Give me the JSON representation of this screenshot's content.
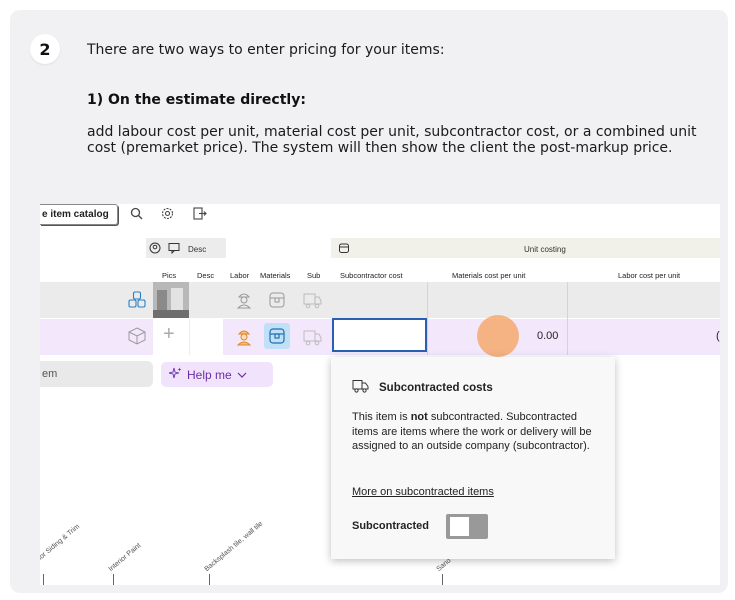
{
  "step": {
    "number": "2",
    "intro": "There are two ways to enter pricing for your items:",
    "method_heading": "1) On the estimate directly:",
    "paragraph": "add labour cost per unit, material cost per unit, subcontractor cost, or a combined unit cost (premarket price). The system will then show the client the post-markup price."
  },
  "app": {
    "toolbar": {
      "catalog_button": "e item catalog",
      "icons": [
        "search-icon",
        "settings-icon",
        "export-icon"
      ]
    },
    "group_headers": {
      "desc": "Desc",
      "unit_costing": "Unit costing"
    },
    "columns": [
      "Pics",
      "Desc",
      "Labor",
      "Materials",
      "Sub",
      "Subcontractor cost",
      "Materials cost per unit",
      "Labor cost per unit"
    ],
    "row2": {
      "materials_value": "0.00",
      "labor_value_partial": "("
    },
    "item_input": "em",
    "help_button": "Help me",
    "popover": {
      "title": "Subcontracted costs",
      "body_pre": "This item is ",
      "body_bold": "not",
      "body_post": " subcontracted. Subcontracted items are items where the work or delivery will be assigned to an outside company (subcontractor).",
      "link": "More on subcontracted items",
      "toggle_label": "Subcontracted",
      "toggle_on": false
    },
    "categories": [
      "rior Siding & Trim",
      "Interior Paint",
      "Backsplash tile, wall tile",
      "Sand"
    ]
  },
  "colors": {
    "accent_purple": "#6a2ea8",
    "active_border": "#2a5fb3",
    "labor_icon": "#f0a040",
    "materials_icon": "#2a8fd0",
    "click_marker": "#f6a15c"
  }
}
